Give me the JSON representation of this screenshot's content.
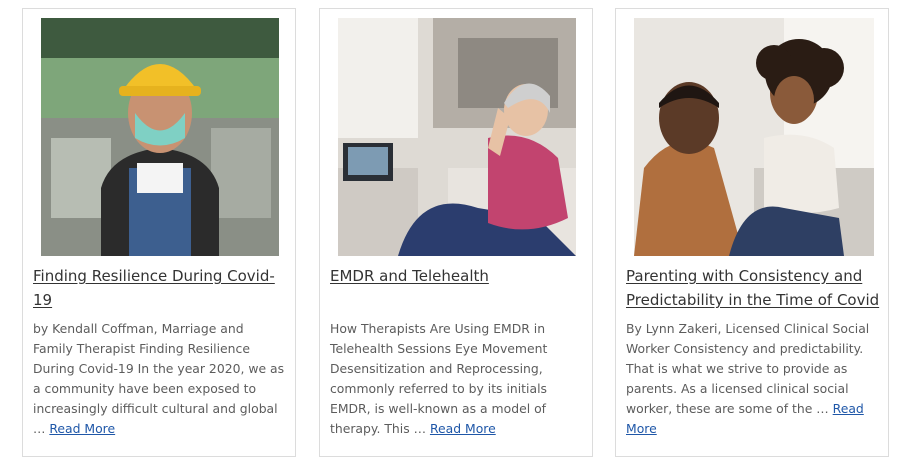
{
  "cards": [
    {
      "image_alt": "Worker in hard hat and face mask",
      "title": "Finding Resilience During Covid-19",
      "excerpt": "by Kendall Coffman, Marriage and Family Therapist Finding Resilience During Covid-19 In the year 2020, we as a community have been exposed to increasingly difficult cultural and global …",
      "read_more": "Read More"
    },
    {
      "image_alt": "Woman on a video call with her therapist",
      "title": "EMDR and Telehealth",
      "excerpt": "How Therapists Are Using EMDR in Telehealth Sessions Eye Movement Desensitization and Reprocessing, commonly referred to by its initials EMDR, is well-known as a model of therapy. This …",
      "read_more": "Read More"
    },
    {
      "image_alt": "Father talking with his young daughter",
      "title": "Parenting with Consistency and Predictability in the Time of Covid",
      "excerpt": "By Lynn Zakeri, Licensed Clinical Social Worker Consistency and predictability. That is what we strive to provide as parents. As a licensed clinical social worker, these are some of the …",
      "read_more": "Read More"
    }
  ],
  "colors": {
    "title": "#333333",
    "excerpt": "#5c5c5c",
    "link": "#1f57a8",
    "card_border": "#dcdcdc"
  }
}
